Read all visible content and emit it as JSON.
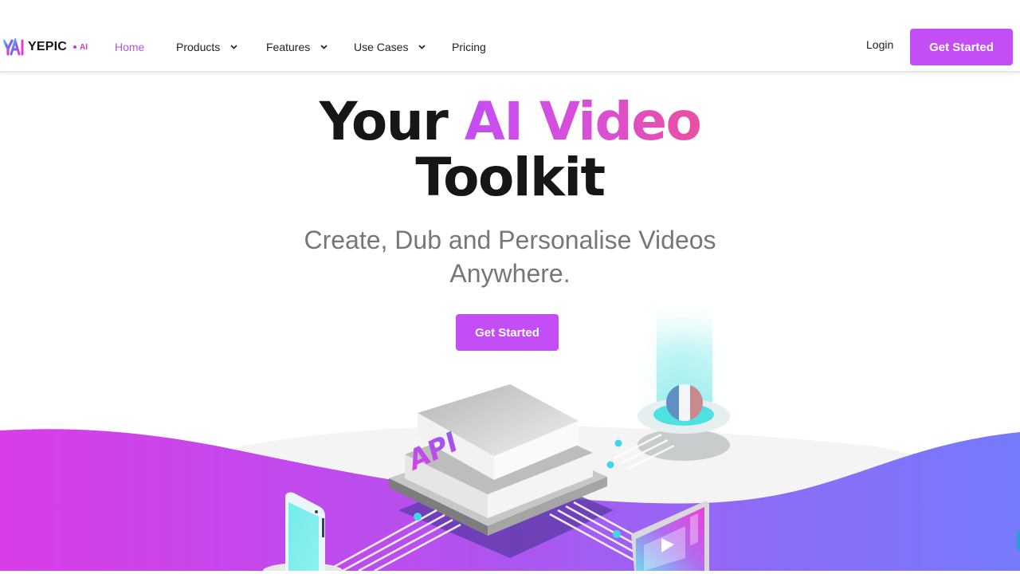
{
  "brand": {
    "name": "YEPIC",
    "suffix": "AI",
    "logo_icon": "yepic-ai-logo-icon"
  },
  "nav": {
    "items": [
      {
        "label": "Home",
        "active": true,
        "has_dropdown": false
      },
      {
        "label": "Products",
        "active": false,
        "has_dropdown": true
      },
      {
        "label": "Features",
        "active": false,
        "has_dropdown": true
      },
      {
        "label": "Use Cases",
        "active": false,
        "has_dropdown": true
      },
      {
        "label": "Pricing",
        "active": false,
        "has_dropdown": false
      }
    ],
    "login_label": "Login",
    "cta_label": "Get Started"
  },
  "hero": {
    "title_prefix": "Your",
    "title_highlight": "AI Video",
    "title_suffix": "Toolkit",
    "subtitle_line1": "Create, Dub and Personalise Videos",
    "subtitle_line2": "Anywhere.",
    "cta_label": "Get Started"
  },
  "illustration": {
    "chip_label": "API",
    "devices": [
      "smartphone",
      "video-monitor",
      "french-flag-globe-hologram"
    ]
  },
  "colors": {
    "accent": "#c34ef5",
    "accent_pink": "#ec4fa0",
    "wave_left": "#d63fe6",
    "wave_right": "#7679fb",
    "hologram": "#5fe6e6",
    "nav_text": "#222222",
    "subtitle_text": "#777777"
  }
}
